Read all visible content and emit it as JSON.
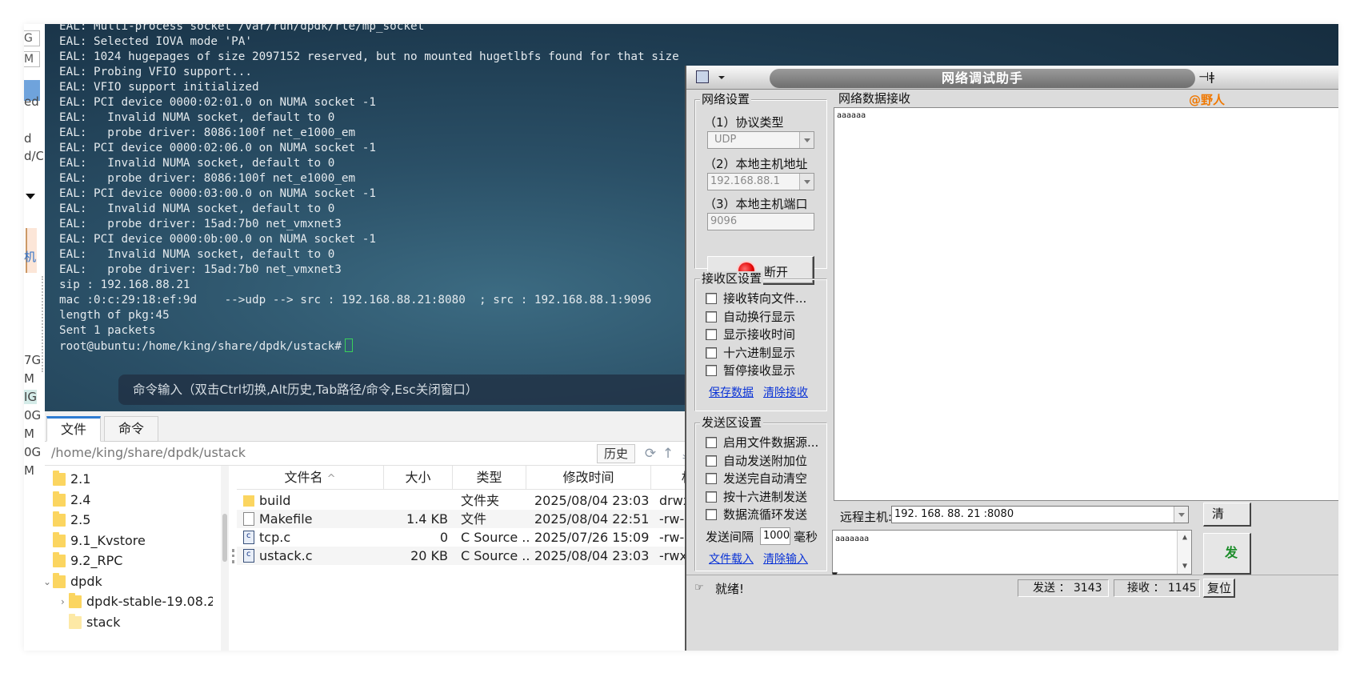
{
  "left_strip": {
    "fragments": [
      "G",
      "M",
      "ed",
      "d",
      "d/C",
      "机",
      "7G",
      "M",
      "IG",
      "0G",
      "M",
      "0G",
      "M"
    ]
  },
  "terminal": {
    "lines": [
      "EAL: Multi-process socket /var/run/dpdk/rte/mp_socket",
      "EAL: Selected IOVA mode 'PA'",
      "EAL: 1024 hugepages of size 2097152 reserved, but no mounted hugetlbfs found for that size",
      "EAL: Probing VFIO support...",
      "EAL: VFIO support initialized",
      "EAL: PCI device 0000:02:01.0 on NUMA socket -1",
      "EAL:   Invalid NUMA socket, default to 0",
      "EAL:   probe driver: 8086:100f net_e1000_em",
      "EAL: PCI device 0000:02:06.0 on NUMA socket -1",
      "EAL:   Invalid NUMA socket, default to 0",
      "EAL:   probe driver: 8086:100f net_e1000_em",
      "EAL: PCI device 0000:03:00.0 on NUMA socket -1",
      "EAL:   Invalid NUMA socket, default to 0",
      "EAL:   probe driver: 15ad:7b0 net_vmxnet3",
      "EAL: PCI device 0000:0b:00.0 on NUMA socket -1",
      "EAL:   Invalid NUMA socket, default to 0",
      "EAL:   probe driver: 15ad:7b0 net_vmxnet3",
      "sip : 192.168.88.21",
      "mac :0:c:29:18:ef:9d    -->udp --> src : 192.168.88.21:8080  ; src : 192.168.88.1:9096",
      "length of pkg:45",
      "Sent 1 packets"
    ],
    "prompt": "root@ubuntu:/home/king/share/dpdk/ustack#",
    "command_hint": "命令输入（双击Ctrl切换,Alt历史,Tab路径/命令,Esc关闭窗口）"
  },
  "file_manager": {
    "tabs": [
      {
        "label": "文件",
        "active": true
      },
      {
        "label": "命令",
        "active": false
      }
    ],
    "path": "/home/king/share/dpdk/ustack",
    "history_label": "历史",
    "toolbar_icons": [
      "refresh-icon",
      "up-dir-icon",
      "download-icon",
      "upload-icon"
    ],
    "tree": [
      {
        "label": "2.1",
        "indent": 0
      },
      {
        "label": "2.4",
        "indent": 0
      },
      {
        "label": "2.5",
        "indent": 0
      },
      {
        "label": "9.1_Kvstore",
        "indent": 0
      },
      {
        "label": "9.2_RPC",
        "indent": 0
      },
      {
        "label": "dpdk",
        "indent": 0,
        "expanded": true
      },
      {
        "label": "dpdk-stable-19.08.2",
        "indent": 1,
        "expandable": true
      },
      {
        "label": "stack",
        "indent": 1
      }
    ],
    "columns": [
      "文件名",
      "大小",
      "类型",
      "修改时间",
      "权限"
    ],
    "sort_indicator": "^",
    "files": [
      {
        "name": "build",
        "size": "",
        "type": "文件夹",
        "modified": "2025/08/04 23:03",
        "perms": "drwxr-xr",
        "icon": "folder"
      },
      {
        "name": "Makefile",
        "size": "1.4 KB",
        "type": "文件",
        "modified": "2025/08/04 22:51",
        "perms": "-rw-rw-r",
        "icon": "doc"
      },
      {
        "name": "tcp.c",
        "size": "0",
        "type": "C Source ...",
        "modified": "2025/07/26 15:09",
        "perms": "-rw-r--r-",
        "icon": "cfile"
      },
      {
        "name": "ustack.c",
        "size": "20 KB",
        "type": "C Source ...",
        "modified": "2025/08/04 23:03",
        "perms": "-rwxr--r-",
        "icon": "cfile"
      }
    ]
  },
  "net_tool": {
    "title": "网络调试助手",
    "watermark": "@野人",
    "net_settings": {
      "group_title": "网络设置",
      "protocol_label": "（1）协议类型",
      "protocol_value": "UDP",
      "local_ip_label": "（2）本地主机地址",
      "local_ip_value": "192.168.88.1",
      "local_port_label": "（3）本地主机端口",
      "local_port_value": "9096",
      "disconnect_label": "断开"
    },
    "recv_settings": {
      "group_title": "接收区设置",
      "options": [
        "接收转向文件...",
        "自动换行显示",
        "显示接收时间",
        "十六进制显示",
        "暂停接收显示"
      ],
      "save_link": "保存数据",
      "clear_link": "清除接收"
    },
    "send_settings": {
      "group_title": "发送区设置",
      "options": [
        "启用文件数据源...",
        "自动发送附加位",
        "发送完自动清空",
        "按十六进制发送",
        "数据流循环发送"
      ],
      "interval_label": "发送间隔",
      "interval_value": "1000",
      "interval_unit": "毫秒",
      "load_link": "文件载入",
      "clear_link": "清除输入"
    },
    "recv_area": {
      "title": "网络数据接收",
      "content": "aaaaaa"
    },
    "remote": {
      "label": "远程主机:",
      "value": "192. 168. 88. 21 :8080",
      "clear_btn": "清"
    },
    "send_area": {
      "content": "aaaaaaa",
      "send_btn": "发"
    },
    "status": {
      "ready": "就绪!",
      "sent": "发送 ： 3143",
      "recv": "接收 ： 1145",
      "reset": "复位"
    }
  }
}
